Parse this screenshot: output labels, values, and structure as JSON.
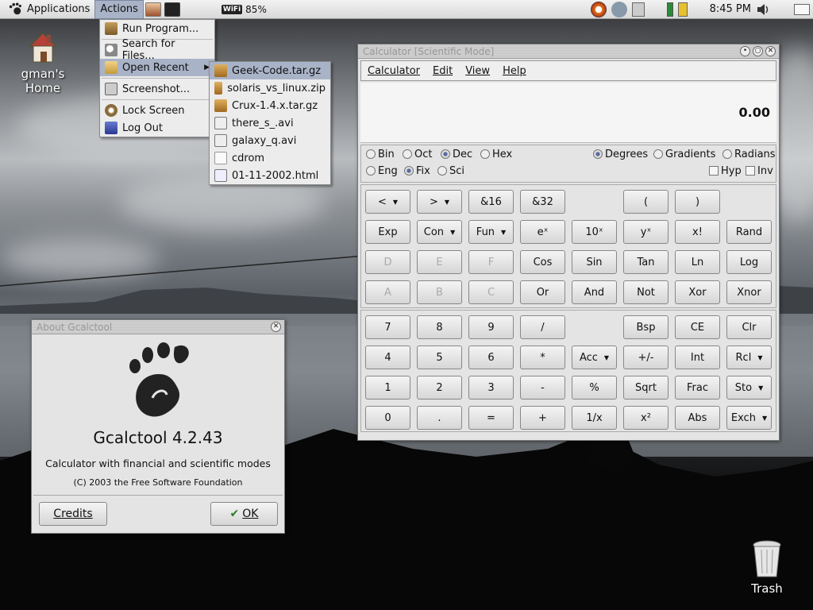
{
  "panel": {
    "menus": [
      "Applications",
      "Actions"
    ],
    "wifi_label": "WiFi",
    "battery": "85%",
    "clock": "8:45 PM"
  },
  "desktop": {
    "home_label": "gman's Home",
    "trash_label": "Trash"
  },
  "actions_menu": {
    "items": [
      "Run Program...",
      "Search for Files...",
      "Open Recent",
      "Screenshot...",
      "Lock Screen",
      "Log Out"
    ]
  },
  "recent_menu": {
    "items": [
      "Geek-Code.tar.gz",
      "solaris_vs_linux.zip",
      "Crux-1.4.x.tar.gz",
      "there_s_.avi",
      "galaxy_q.avi",
      "cdrom",
      "01-11-2002.html"
    ]
  },
  "calculator": {
    "title": "Calculator  [Scientific Mode]",
    "menus": [
      "Calculator",
      "Edit",
      "View",
      "Help"
    ],
    "display": "0.00",
    "bases": [
      "Bin",
      "Oct",
      "Dec",
      "Hex"
    ],
    "base_selected": "Dec",
    "angles": [
      "Degrees",
      "Gradients",
      "Radians"
    ],
    "angle_selected": "Degrees",
    "notations": [
      "Eng",
      "Fix",
      "Sci"
    ],
    "notation_selected": "Fix",
    "checks": [
      "Hyp",
      "Inv"
    ],
    "sci_rows": [
      [
        "<",
        ">",
        "&16",
        "&32",
        "",
        "(",
        ")",
        ""
      ],
      [
        "Exp",
        "Con",
        "Fun",
        "eˣ",
        "10ˣ",
        "yˣ",
        "x!",
        "Rand"
      ],
      [
        "D",
        "E",
        "F",
        "Cos",
        "Sin",
        "Tan",
        "Ln",
        "Log"
      ],
      [
        "A",
        "B",
        "C",
        "Or",
        "And",
        "Not",
        "Xor",
        "Xnor"
      ]
    ],
    "basic_rows": [
      [
        "7",
        "8",
        "9",
        "/",
        "",
        "Bsp",
        "CE",
        "Clr"
      ],
      [
        "4",
        "5",
        "6",
        "*",
        "Acc",
        "+/-",
        "Int",
        "Rcl"
      ],
      [
        "1",
        "2",
        "3",
        "-",
        "%",
        "Sqrt",
        "Frac",
        "Sto"
      ],
      [
        "0",
        ".",
        "=",
        "+",
        "1/x",
        "x²",
        "Abs",
        "Exch"
      ]
    ]
  },
  "about": {
    "title": "About Gcalctool",
    "app_name": "Gcalctool 4.2.43",
    "description": "Calculator with financial and scientific modes",
    "copyright": "(C) 2003 the Free Software Foundation",
    "credits_label": "Credits",
    "ok_label": "OK"
  }
}
